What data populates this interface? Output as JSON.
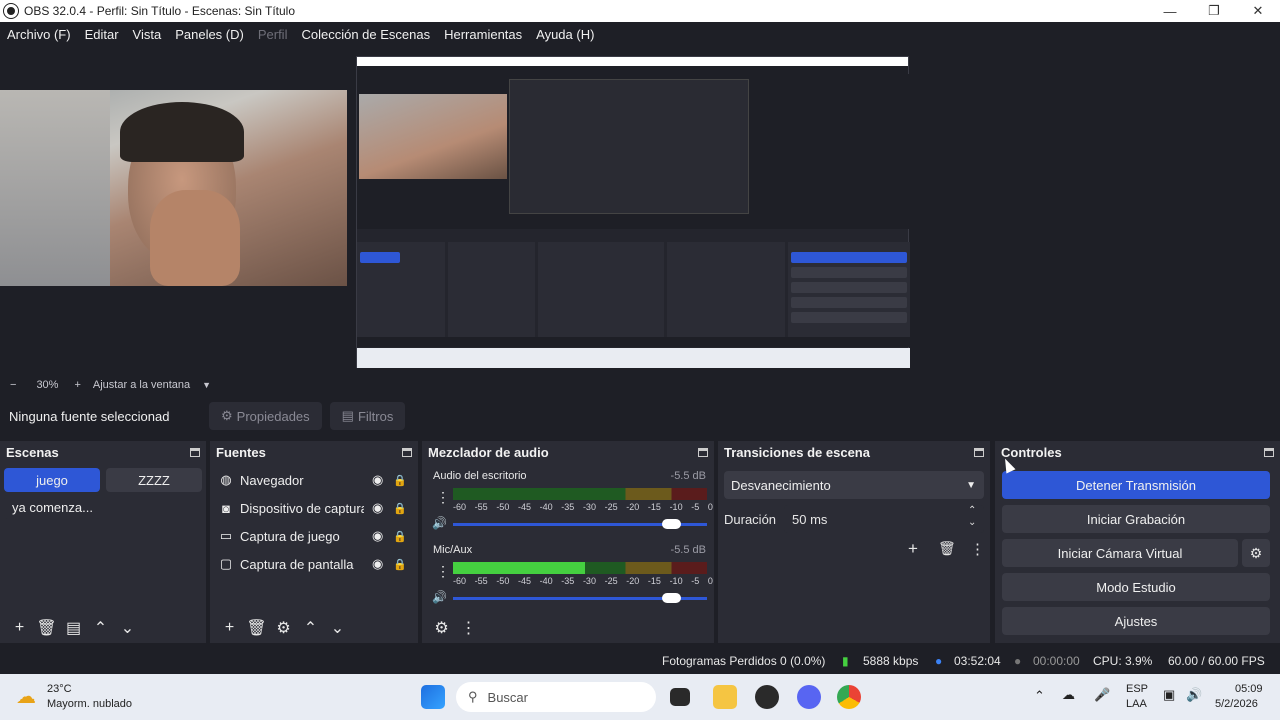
{
  "window": {
    "title": "OBS 32.0.4 - Perfil: Sin Título - Escenas: Sin Título"
  },
  "menu": [
    {
      "label": "Archivo (F)",
      "enabled": true
    },
    {
      "label": "Editar",
      "enabled": true
    },
    {
      "label": "Vista",
      "enabled": true
    },
    {
      "label": "Paneles (D)",
      "enabled": true
    },
    {
      "label": "Perfil",
      "enabled": false
    },
    {
      "label": "Colección de Escenas",
      "enabled": true
    },
    {
      "label": "Herramientas",
      "enabled": true
    },
    {
      "label": "Ayuda (H)",
      "enabled": true
    }
  ],
  "zoom": {
    "minus": "−",
    "value": "30%",
    "plus": "+",
    "fit": "Ajustar a la ventana"
  },
  "source_toolbar": {
    "selected": "Ninguna fuente seleccionad",
    "properties": "Propiedades",
    "filters": "Filtros"
  },
  "scenes": {
    "title": "Escenas",
    "items": [
      {
        "label": "juego",
        "active": true
      },
      {
        "label": "ZZZZ",
        "active": false
      },
      {
        "label": "ya comenza...",
        "active": false
      }
    ]
  },
  "sources": {
    "title": "Fuentes",
    "items": [
      {
        "label": "Navegador",
        "icon": "globe-icon"
      },
      {
        "label": "Dispositivo de captura",
        "icon": "camera-icon"
      },
      {
        "label": "Captura de juego",
        "icon": "gamepad-icon"
      },
      {
        "label": "Captura de pantalla",
        "icon": "monitor-icon"
      }
    ]
  },
  "mixer": {
    "title": "Mezclador de audio",
    "ticks": [
      "-60",
      "-55",
      "-50",
      "-45",
      "-40",
      "-35",
      "-30",
      "-25",
      "-20",
      "-15",
      "-10",
      "-5",
      "0"
    ],
    "channels": [
      {
        "name": "Audio del escritorio",
        "db": "-5.5 dB",
        "level": 0.0,
        "volume": 0.86
      },
      {
        "name": "Mic/Aux",
        "db": "-5.5 dB",
        "level": 0.52,
        "volume": 0.86
      }
    ]
  },
  "transitions": {
    "title": "Transiciones de escena",
    "selected": "Desvanecimiento",
    "duration_label": "Duración",
    "duration_value": "50 ms"
  },
  "controls": {
    "title": "Controles",
    "buttons": [
      "Detener Transmisión",
      "Iniciar Grabación",
      "Iniciar Cámara Virtual",
      "Modo Estudio",
      "Ajustes"
    ]
  },
  "status": {
    "dropped": "Fotogramas Perdidos 0 (0.0%)",
    "bitrate": "5888 kbps",
    "stream_time": "03:52:04",
    "rec_time": "00:00:00",
    "cpu": "CPU: 3.9%",
    "fps": "60.00 / 60.00 FPS"
  },
  "taskbar": {
    "weather_temp": "23°C",
    "weather_desc": "Mayorm. nublado",
    "search": "Buscar",
    "lang": "ESP",
    "lang2": "LAA",
    "time": "05:09",
    "date": "5/2/2026"
  },
  "colors": {
    "accent": "#2e57d6",
    "dock_bg": "#2b2c35",
    "app_bg": "#1e1f26"
  }
}
